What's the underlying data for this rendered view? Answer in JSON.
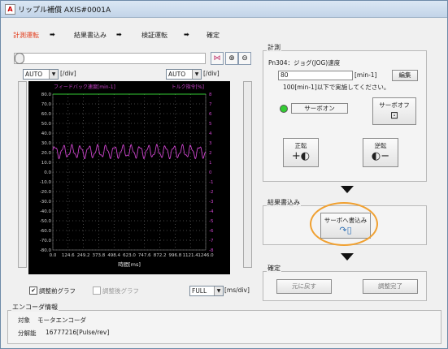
{
  "window": {
    "title": "リップル補償 AXIS#0001A",
    "icon": "a-logo"
  },
  "steps": [
    {
      "label": "計測運転",
      "active": true
    },
    {
      "label": "結果書込み",
      "active": false
    },
    {
      "label": "検証運転",
      "active": false
    },
    {
      "label": "確定",
      "active": false
    }
  ],
  "chart_toolbar": {
    "icons": [
      "tune-icon",
      "zoom-in-icon",
      "zoom-out-icon"
    ]
  },
  "left_axis": {
    "scale": "AUTO",
    "unit": "[/div]"
  },
  "right_axis": {
    "scale": "AUTO",
    "unit": "[/div]"
  },
  "chart_data": {
    "type": "line",
    "left_label": "フィードバック速度[min-1]",
    "right_label": "トルク指令[%]",
    "xlabel": "時間[ms]",
    "x_ticks": [
      "0.0",
      "124.6",
      "249.2",
      "373.8",
      "498.4",
      "623.0",
      "747.6",
      "872.2",
      "996.8",
      "1121.4",
      "1246.0"
    ],
    "y_left_ticks": [
      "80.0",
      "70.0",
      "60.0",
      "50.0",
      "40.0",
      "30.0",
      "20.0",
      "10.0",
      "0.0",
      "-10.0",
      "-20.0",
      "-30.0",
      "-40.0",
      "-50.0",
      "-60.0",
      "-70.0",
      "-80.0"
    ],
    "y_right_ticks": [
      "8",
      "7",
      "6",
      "5",
      "4",
      "3",
      "2",
      "1",
      "0",
      "-1",
      "-2",
      "-3",
      "-4",
      "-5",
      "-6",
      "-7",
      "-8"
    ],
    "ylim_left": [
      -80,
      80
    ],
    "ylim_right": [
      -8,
      8
    ],
    "xlim": [
      0,
      1246
    ],
    "series": [
      {
        "color": "#33cc33",
        "axis": "left",
        "constant": 80
      },
      {
        "color": "#cc44cc",
        "axis": "right",
        "mean": 2.1,
        "amplitude": 0.55,
        "cycles": 18
      }
    ],
    "grid": true
  },
  "graph_options": {
    "before": {
      "label": "調整前グラフ",
      "checked": true
    },
    "after": {
      "label": "調整後グラフ",
      "checked": false
    },
    "time_scale": "FULL",
    "time_unit": "[ms/div]"
  },
  "measure": {
    "group_title": "計測",
    "param": "Pn304：ジョグ(JOG)速度",
    "value": "80",
    "unit": "[min-1]",
    "edit_btn": "編集",
    "note": "100[min-1]以下で実施してください。",
    "servo_status": "サーボオン",
    "servo_off_btn": "サーボオフ",
    "forward_btn": "正転",
    "reverse_btn": "逆転"
  },
  "write": {
    "group_title": "結果書込み",
    "btn": "サーボへ書込み"
  },
  "confirm": {
    "group_title": "確定",
    "back_btn": "元に戻す",
    "done_btn": "調整完了"
  },
  "encoder": {
    "group_title": "エンコーダ情報",
    "type_label": "対象",
    "type_value": "モータエンコーダ",
    "res_label": "分解能",
    "res_value": "16777216[Pulse/rev]"
  }
}
